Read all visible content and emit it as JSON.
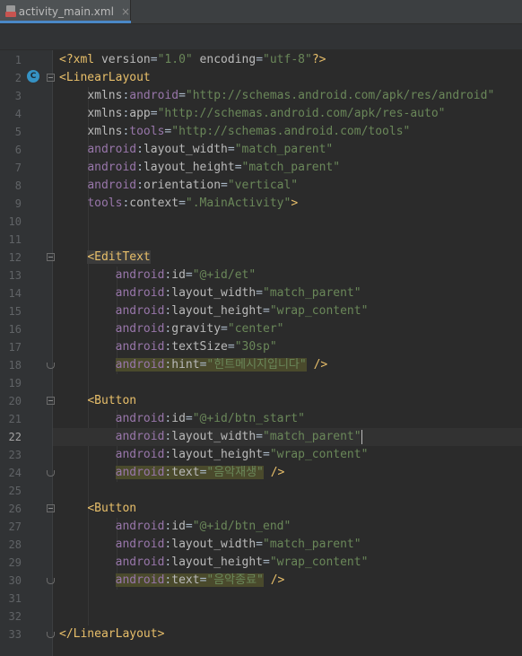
{
  "tab": {
    "filename": "activity_main.xml",
    "close": "×"
  },
  "gutter_marker": "C",
  "lines": [
    {
      "n": "1",
      "tokens": [
        [
          "t-xmldecl",
          "<?xml "
        ],
        [
          "t-attr",
          "version"
        ],
        [
          "t-punct",
          "="
        ],
        [
          "t-val",
          "\"1.0\""
        ],
        [
          "t-attr",
          " encoding"
        ],
        [
          "t-punct",
          "="
        ],
        [
          "t-val",
          "\"utf-8\""
        ],
        [
          "t-xmldecl",
          "?>"
        ]
      ]
    },
    {
      "n": "2",
      "tokens": [
        [
          "t-tag",
          "<LinearLayout"
        ]
      ]
    },
    {
      "n": "3",
      "tokens": [
        [
          "t-punct",
          "    "
        ],
        [
          "t-attr",
          "xmlns"
        ],
        [
          "t-punct",
          ":"
        ],
        [
          "t-ns",
          "android"
        ],
        [
          "t-punct",
          "="
        ],
        [
          "t-val",
          "\"http://schemas.android.com/apk/res/android\""
        ]
      ]
    },
    {
      "n": "4",
      "tokens": [
        [
          "t-punct",
          "    "
        ],
        [
          "t-attr",
          "xmlns"
        ],
        [
          "t-punct",
          ":"
        ],
        [
          "t-attr",
          "app"
        ],
        [
          "t-punct",
          "="
        ],
        [
          "t-val",
          "\"http://schemas.android.com/apk/res-auto\""
        ]
      ]
    },
    {
      "n": "5",
      "tokens": [
        [
          "t-punct",
          "    "
        ],
        [
          "t-attr",
          "xmlns"
        ],
        [
          "t-punct",
          ":"
        ],
        [
          "t-ns",
          "tools"
        ],
        [
          "t-punct",
          "="
        ],
        [
          "t-val",
          "\"http://schemas.android.com/tools\""
        ]
      ]
    },
    {
      "n": "6",
      "tokens": [
        [
          "t-punct",
          "    "
        ],
        [
          "t-ns",
          "android"
        ],
        [
          "t-punct",
          ":"
        ],
        [
          "t-attr",
          "layout_width"
        ],
        [
          "t-punct",
          "="
        ],
        [
          "t-val",
          "\"match_parent\""
        ]
      ]
    },
    {
      "n": "7",
      "tokens": [
        [
          "t-punct",
          "    "
        ],
        [
          "t-ns",
          "android"
        ],
        [
          "t-punct",
          ":"
        ],
        [
          "t-attr",
          "layout_height"
        ],
        [
          "t-punct",
          "="
        ],
        [
          "t-val",
          "\"match_parent\""
        ]
      ]
    },
    {
      "n": "8",
      "tokens": [
        [
          "t-punct",
          "    "
        ],
        [
          "t-ns",
          "android"
        ],
        [
          "t-punct",
          ":"
        ],
        [
          "t-attr",
          "orientation"
        ],
        [
          "t-punct",
          "="
        ],
        [
          "t-val",
          "\"vertical\""
        ]
      ]
    },
    {
      "n": "9",
      "tokens": [
        [
          "t-punct",
          "    "
        ],
        [
          "t-ns",
          "tools"
        ],
        [
          "t-punct",
          ":"
        ],
        [
          "t-attr",
          "context"
        ],
        [
          "t-punct",
          "="
        ],
        [
          "t-val",
          "\".MainActivity\""
        ],
        [
          "t-tag",
          ">"
        ]
      ]
    },
    {
      "n": "10",
      "tokens": []
    },
    {
      "n": "11",
      "tokens": []
    },
    {
      "n": "12",
      "tokens": [
        [
          "t-punct",
          "    "
        ],
        [
          "t-tag hl-tag",
          "<EditText"
        ]
      ]
    },
    {
      "n": "13",
      "tokens": [
        [
          "t-punct",
          "        "
        ],
        [
          "t-ns",
          "android"
        ],
        [
          "t-punct",
          ":"
        ],
        [
          "t-attr",
          "id"
        ],
        [
          "t-punct",
          "="
        ],
        [
          "t-val",
          "\"@+id/et\""
        ]
      ]
    },
    {
      "n": "14",
      "tokens": [
        [
          "t-punct",
          "        "
        ],
        [
          "t-ns",
          "android"
        ],
        [
          "t-punct",
          ":"
        ],
        [
          "t-attr",
          "layout_width"
        ],
        [
          "t-punct",
          "="
        ],
        [
          "t-val",
          "\"match_parent\""
        ]
      ]
    },
    {
      "n": "15",
      "tokens": [
        [
          "t-punct",
          "        "
        ],
        [
          "t-ns",
          "android"
        ],
        [
          "t-punct",
          ":"
        ],
        [
          "t-attr",
          "layout_height"
        ],
        [
          "t-punct",
          "="
        ],
        [
          "t-val",
          "\"wrap_content\""
        ]
      ]
    },
    {
      "n": "16",
      "tokens": [
        [
          "t-punct",
          "        "
        ],
        [
          "t-ns",
          "android"
        ],
        [
          "t-punct",
          ":"
        ],
        [
          "t-attr",
          "gravity"
        ],
        [
          "t-punct",
          "="
        ],
        [
          "t-val",
          "\"center\""
        ]
      ]
    },
    {
      "n": "17",
      "tokens": [
        [
          "t-punct",
          "        "
        ],
        [
          "t-ns",
          "android"
        ],
        [
          "t-punct",
          ":"
        ],
        [
          "t-attr",
          "textSize"
        ],
        [
          "t-punct",
          "="
        ],
        [
          "t-val",
          "\"30sp\""
        ]
      ]
    },
    {
      "n": "18",
      "tokens": [
        [
          "t-punct",
          "        "
        ],
        [
          "t-ns hl-attr",
          "android"
        ],
        [
          "t-punct hl-attr",
          ":"
        ],
        [
          "t-attr hl-attr",
          "hint"
        ],
        [
          "t-punct hl-attr",
          "="
        ],
        [
          "t-val hl-attr",
          "\"힌트메시지입니다\""
        ],
        [
          "t-punct",
          " "
        ],
        [
          "t-tag",
          "/>"
        ]
      ]
    },
    {
      "n": "19",
      "tokens": []
    },
    {
      "n": "20",
      "tokens": [
        [
          "t-punct",
          "    "
        ],
        [
          "t-tag",
          "<Button"
        ]
      ]
    },
    {
      "n": "21",
      "tokens": [
        [
          "t-punct",
          "        "
        ],
        [
          "t-ns",
          "android"
        ],
        [
          "t-punct",
          ":"
        ],
        [
          "t-attr",
          "id"
        ],
        [
          "t-punct",
          "="
        ],
        [
          "t-val",
          "\"@+id/btn_start\""
        ]
      ]
    },
    {
      "n": "22",
      "current": true,
      "tokens": [
        [
          "t-punct",
          "        "
        ],
        [
          "t-ns",
          "android"
        ],
        [
          "t-punct",
          ":"
        ],
        [
          "t-attr",
          "layout_width"
        ],
        [
          "t-punct",
          "="
        ],
        [
          "t-val",
          "\"match_parent\""
        ]
      ]
    },
    {
      "n": "23",
      "tokens": [
        [
          "t-punct",
          "        "
        ],
        [
          "t-ns",
          "android"
        ],
        [
          "t-punct",
          ":"
        ],
        [
          "t-attr",
          "layout_height"
        ],
        [
          "t-punct",
          "="
        ],
        [
          "t-val",
          "\"wrap_content\""
        ]
      ]
    },
    {
      "n": "24",
      "tokens": [
        [
          "t-punct",
          "        "
        ],
        [
          "t-ns hl-attr",
          "android"
        ],
        [
          "t-punct hl-attr",
          ":"
        ],
        [
          "t-attr hl-attr",
          "text"
        ],
        [
          "t-punct hl-attr",
          "="
        ],
        [
          "t-val hl-attr",
          "\"음악재생\""
        ],
        [
          "t-punct",
          " "
        ],
        [
          "t-tag",
          "/>"
        ]
      ]
    },
    {
      "n": "25",
      "tokens": []
    },
    {
      "n": "26",
      "tokens": [
        [
          "t-punct",
          "    "
        ],
        [
          "t-tag",
          "<Button"
        ]
      ]
    },
    {
      "n": "27",
      "tokens": [
        [
          "t-punct",
          "        "
        ],
        [
          "t-ns",
          "android"
        ],
        [
          "t-punct",
          ":"
        ],
        [
          "t-attr",
          "id"
        ],
        [
          "t-punct",
          "="
        ],
        [
          "t-val",
          "\"@+id/btn_end\""
        ]
      ]
    },
    {
      "n": "28",
      "tokens": [
        [
          "t-punct",
          "        "
        ],
        [
          "t-ns",
          "android"
        ],
        [
          "t-punct",
          ":"
        ],
        [
          "t-attr",
          "layout_width"
        ],
        [
          "t-punct",
          "="
        ],
        [
          "t-val",
          "\"match_parent\""
        ]
      ]
    },
    {
      "n": "29",
      "tokens": [
        [
          "t-punct",
          "        "
        ],
        [
          "t-ns",
          "android"
        ],
        [
          "t-punct",
          ":"
        ],
        [
          "t-attr",
          "layout_height"
        ],
        [
          "t-punct",
          "="
        ],
        [
          "t-val",
          "\"wrap_content\""
        ]
      ]
    },
    {
      "n": "30",
      "tokens": [
        [
          "t-punct",
          "        "
        ],
        [
          "t-ns hl-attr",
          "android"
        ],
        [
          "t-punct hl-attr",
          ":"
        ],
        [
          "t-attr hl-attr",
          "text"
        ],
        [
          "t-punct hl-attr",
          "="
        ],
        [
          "t-val hl-attr",
          "\"음악종료\""
        ],
        [
          "t-punct",
          " "
        ],
        [
          "t-tag",
          "/>"
        ]
      ]
    },
    {
      "n": "31",
      "tokens": []
    },
    {
      "n": "32",
      "tokens": []
    },
    {
      "n": "33",
      "tokens": [
        [
          "t-tag",
          "</LinearLayout>"
        ]
      ]
    }
  ],
  "folds": {
    "2": "open",
    "12": "open",
    "18": "end",
    "20": "open",
    "24": "end",
    "26": "open",
    "30": "end",
    "33": "end"
  },
  "gutter_markers": {
    "2": "C"
  }
}
